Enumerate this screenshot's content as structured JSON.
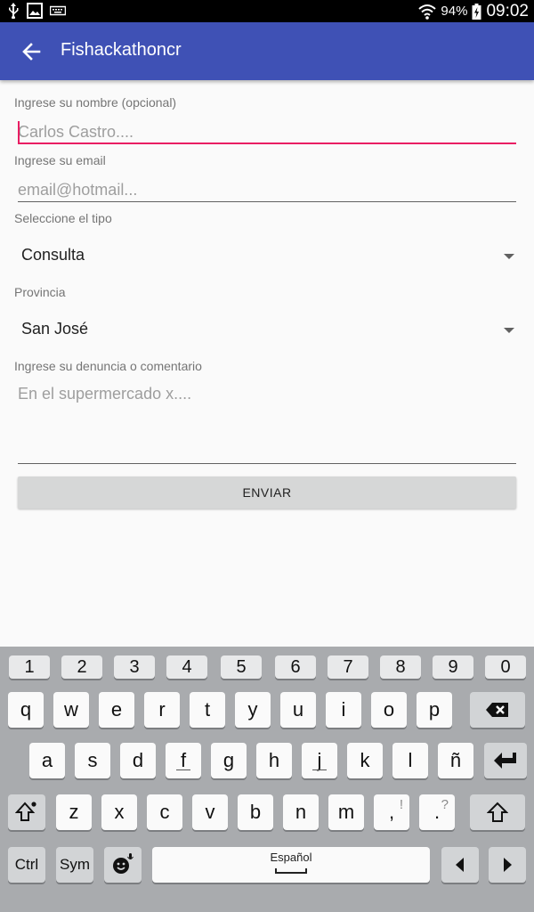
{
  "status_bar": {
    "battery": "94%",
    "time": "09:02",
    "icons": [
      "usb-icon",
      "image-icon",
      "keyboard-icon",
      "wifi-icon",
      "battery-icon"
    ]
  },
  "app_bar": {
    "title": "Fishackathoncr",
    "nav_icon": "arrow-left-icon"
  },
  "form": {
    "name_label": "Ingrese su nombre (opcional)",
    "name_placeholder": "Carlos Castro....",
    "email_label": "Ingrese su email",
    "email_placeholder": "email@hotmail...",
    "type_label": "Seleccione el tipo",
    "type_value": "Consulta",
    "province_label": "Provincia",
    "province_value": "San José",
    "comment_label": "Ingrese su denuncia o comentario",
    "comment_placeholder": "En el supermercado x....",
    "submit_label": "ENVIAR"
  },
  "keyboard": {
    "numbers": [
      "1",
      "2",
      "3",
      "4",
      "5",
      "6",
      "7",
      "8",
      "9",
      "0"
    ],
    "row1": [
      "q",
      "w",
      "e",
      "r",
      "t",
      "y",
      "u",
      "i",
      "o",
      "p"
    ],
    "row2": [
      "a",
      "s",
      "d",
      "f",
      "g",
      "h",
      "j",
      "k",
      "l",
      "ñ"
    ],
    "row3": [
      "z",
      "x",
      "c",
      "v",
      "b",
      "n",
      "m"
    ],
    "comma": ",",
    "comma_alt": "!",
    "period": ".",
    "period_alt": "?",
    "ctrl": "Ctrl",
    "sym": "Sym",
    "space_label": "Español"
  },
  "colors": {
    "primary": "#3f51b5",
    "accent": "#e91e63"
  }
}
